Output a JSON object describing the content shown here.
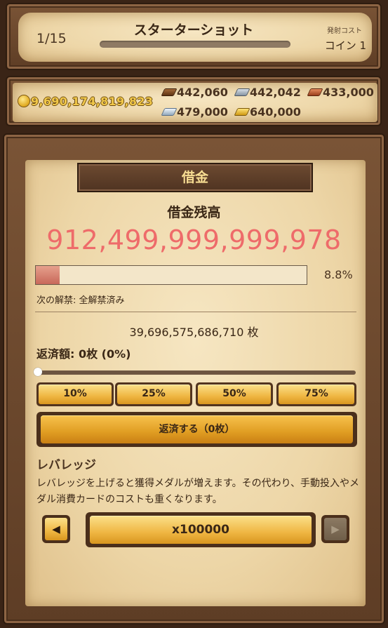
{
  "header": {
    "stage": "1/15",
    "title": "スターターショット",
    "cost_label": "発射コスト",
    "cost_value": "コイン 1"
  },
  "resources": {
    "coins": "9,690,174,819,823",
    "materials": [
      {
        "icon": "wood-log-icon",
        "value": "442,060"
      },
      {
        "icon": "iron-ingot-icon",
        "value": "442,042"
      },
      {
        "icon": "copper-ingot-icon",
        "value": "433,000"
      },
      {
        "icon": "silver-ingot-icon",
        "value": "479,000"
      },
      {
        "icon": "gold-ingot-icon",
        "value": "640,000"
      }
    ]
  },
  "debt": {
    "banner": "借金",
    "label": "借金残高",
    "value": "912,499,999,999,978",
    "progress_percent": 8.8,
    "progress_text": "8.8%",
    "next_unlock": "次の解禁: 全解禁済み",
    "medals": "39,696,575,686,710 枚",
    "repay_amount": "返済額: 0枚 (0%)",
    "slider_value_percent": 0,
    "percent_buttons": [
      "10%",
      "25%",
      "50%",
      "75%"
    ],
    "repay_button": "返済する（0枚）"
  },
  "leverage": {
    "title": "レバレッジ",
    "description": "レバレッジを上げると獲得メダルが増えます。その代わり、手動投入やメダル消費カードのコストも重くなります。",
    "value": "x100000"
  },
  "colors": {
    "debt_value": "#ee6b6a",
    "button_gold": "#efb642",
    "coin_text": "#f1c84a"
  }
}
